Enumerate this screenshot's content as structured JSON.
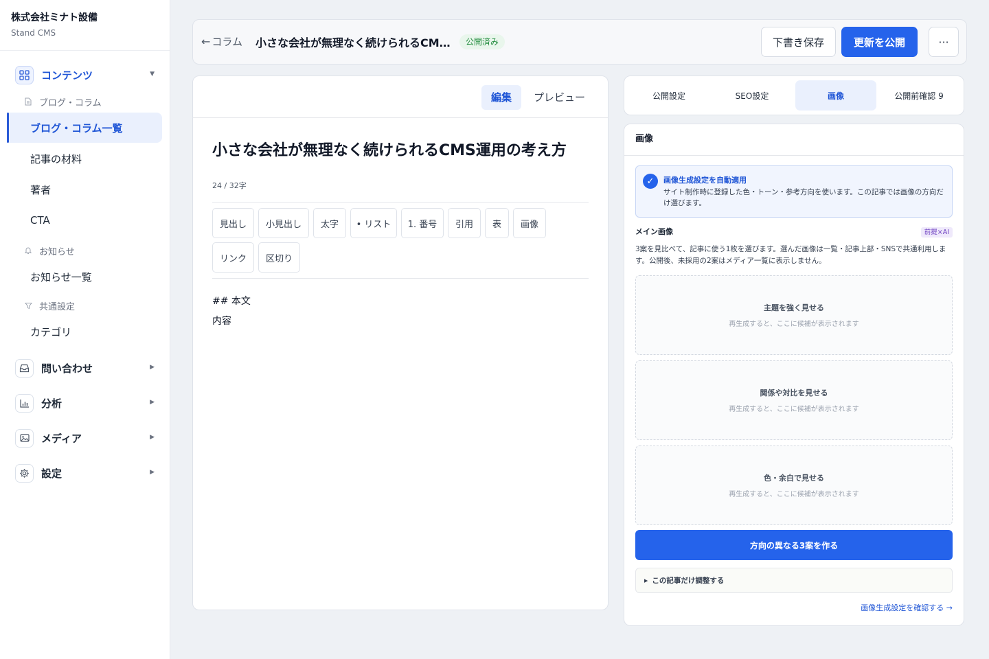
{
  "brand": {
    "name": "株式会社ミナト設備",
    "sub": "Stand CMS"
  },
  "sidebar": {
    "contents_label": "コンテンツ",
    "group_blog": "ブログ・コラム",
    "items_blog": [
      "ブログ・コラム一覧",
      "記事の材料",
      "著者",
      "CTA"
    ],
    "group_news": "お知らせ",
    "items_news": [
      "お知らせ一覧"
    ],
    "group_common": "共通設定",
    "items_common": [
      "カテゴリ"
    ],
    "top_items": [
      "問い合わせ",
      "分析",
      "メディア",
      "設定"
    ]
  },
  "header": {
    "back_label": "コラム",
    "title": "小さな会社が無理なく続けられるCM…",
    "status": "公開済み",
    "draft_label": "下書き保存",
    "publish_label": "更新を公開",
    "more_label": "···"
  },
  "editor": {
    "tab_edit": "編集",
    "tab_preview": "プレビュー",
    "title": "小さな会社が無理なく続けられるCMS運用の考え方",
    "char_count": "24 / 32字",
    "toolbar": [
      "見出し",
      "小見出し",
      "太字",
      "• リスト",
      "1. 番号",
      "引用",
      "表",
      "画像",
      "リンク",
      "区切り"
    ],
    "body_line1": "## 本文",
    "body_line2": "内容"
  },
  "right_tabs": [
    "公開設定",
    "SEO設定",
    "画像",
    "公開前確認 9"
  ],
  "panel": {
    "title": "画像",
    "info_title": "画像生成設定を自動適用",
    "info_desc": "サイト制作時に登録した色・トーン・参考方向を使います。この記事では画像の方向だけ選びます。",
    "main_label": "メイン画像",
    "ai_badge": "前提×AI",
    "main_desc": "3案を見比べて、記事に使う1枚を選びます。選んだ画像は一覧・記事上部・SNSで共通利用します。公開後、未採用の2案はメディア一覧に表示しません。",
    "candidates": [
      {
        "title": "主題を強く見せる",
        "sub": "再生成すると、ここに候補が表示されます"
      },
      {
        "title": "関係や対比を見せる",
        "sub": "再生成すると、ここに候補が表示されます"
      },
      {
        "title": "色・余白で見せる",
        "sub": "再生成すると、ここに候補が表示されます"
      }
    ],
    "generate_label": "方向の異なる3案を作る",
    "adjust_label": "この記事だけ調整する",
    "confirm_link": "画像生成設定を確認する →"
  }
}
